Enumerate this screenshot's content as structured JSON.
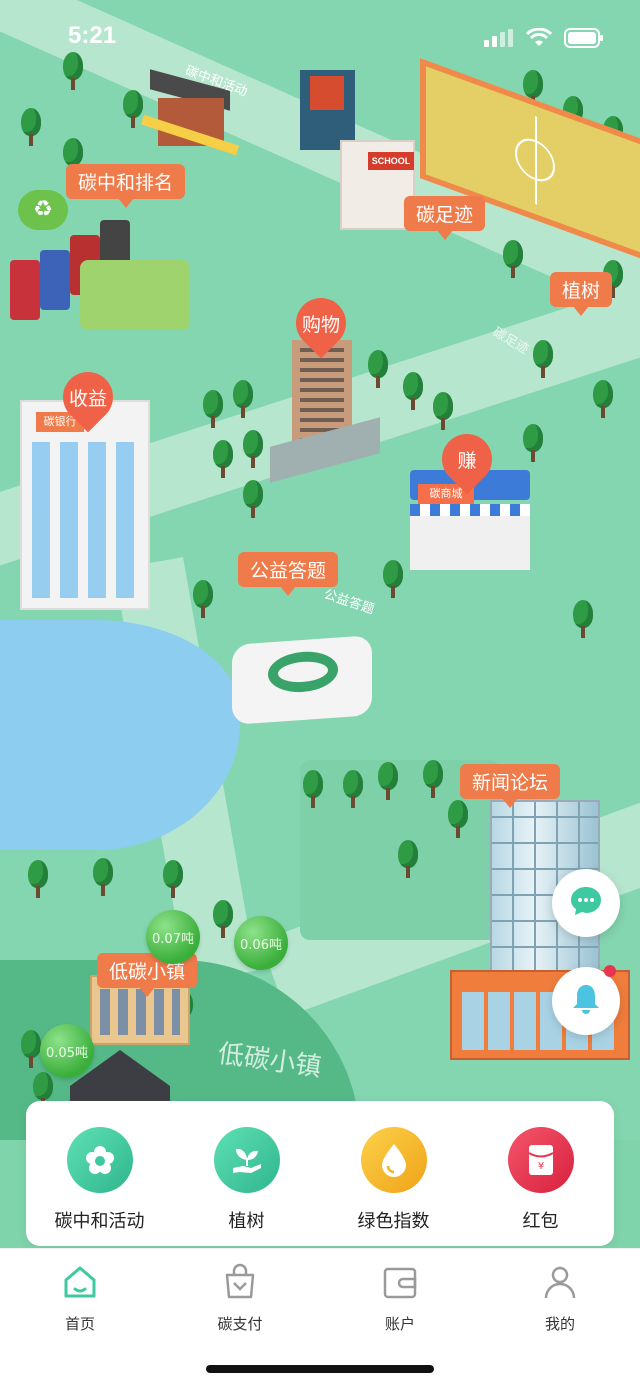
{
  "status_bar": {
    "time": "5:21"
  },
  "map": {
    "tags": {
      "carbon_ranking": "碳中和排名",
      "carbon_footprint": "碳足迹",
      "plant_tree": "植树",
      "shopping": "购物",
      "income": "收益",
      "earn": "赚",
      "quiz": "公益答题",
      "news_forum": "新闻论坛",
      "low_carbon_town": "低碳小镇"
    },
    "bubbles": [
      "0.07吨",
      "0.06吨",
      "0.05吨"
    ],
    "signs": {
      "top_sign": "碳中和活动",
      "school": "SCHOOL",
      "bank": "碳银行",
      "mall": "碳商城",
      "quiz_board": "公益答题",
      "ground_town": "低碳小镇",
      "ground_footprint": "碳足迹"
    }
  },
  "quick_actions": [
    {
      "label": "碳中和活动",
      "icon": "flower-icon",
      "color": "#3fc9a0"
    },
    {
      "label": "植树",
      "icon": "sprout-hand-icon",
      "color": "#3fc9a0"
    },
    {
      "label": "绿色指数",
      "icon": "drop-icon",
      "color": "#f5b41f"
    },
    {
      "label": "红包",
      "icon": "red-packet-icon",
      "color": "#e8344e"
    }
  ],
  "tabs": [
    {
      "label": "首页",
      "icon": "home-icon",
      "active": true
    },
    {
      "label": "碳支付",
      "icon": "shopping-bag-icon",
      "active": false
    },
    {
      "label": "账户",
      "icon": "wallet-icon",
      "active": false
    },
    {
      "label": "我的",
      "icon": "user-icon",
      "active": false
    }
  ],
  "colors": {
    "accent": "#3fc9a0",
    "tag": "#ef7a4a",
    "map_bg": "#84d6b0"
  }
}
